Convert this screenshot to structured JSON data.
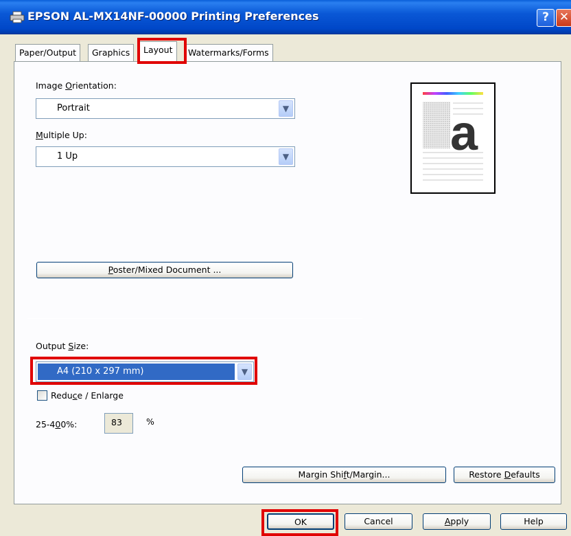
{
  "window": {
    "title": "EPSON AL-MX14NF-00000 Printing Preferences",
    "help_glyph": "?",
    "close_glyph": "✕"
  },
  "tabs": [
    {
      "label": "Paper/Output"
    },
    {
      "label": "Graphics"
    },
    {
      "label": "Layout",
      "active": true
    },
    {
      "label": "Watermarks/Forms"
    }
  ],
  "layout": {
    "orientation": {
      "label_pre": "Image ",
      "label_key": "O",
      "label_post": "rientation:",
      "value": "Portrait"
    },
    "multiple_up": {
      "label_pre": "",
      "label_key": "M",
      "label_post": "ultiple Up:",
      "value": "1 Up"
    },
    "poster_button": {
      "pre": "",
      "key": "P",
      "post": "oster/Mixed Document ..."
    },
    "output_size": {
      "label_pre": "Output ",
      "label_key": "S",
      "label_post": "ize:",
      "value": "A4 (210 x 297 mm)"
    },
    "reduce_enlarge": {
      "pre": "Redu",
      "key": "c",
      "post": "e / Enlarge",
      "checked": false
    },
    "percent": {
      "label_pre": "25-4",
      "label_key": "0",
      "label_post": "0%:",
      "value": "83",
      "unit": "%"
    },
    "margin_button": {
      "pre": "Margin Shi",
      "key": "f",
      "post": "t/Margin..."
    },
    "restore_button": {
      "pre": "Restore ",
      "key": "D",
      "post": "efaults"
    },
    "preview_letter": "a"
  },
  "buttons": {
    "ok": "OK",
    "cancel": "Cancel",
    "apply": {
      "pre": "",
      "key": "A",
      "post": "pply"
    },
    "help": "Help"
  },
  "colors": {
    "highlight_box": "#e00000",
    "selection": "#316ac5"
  }
}
